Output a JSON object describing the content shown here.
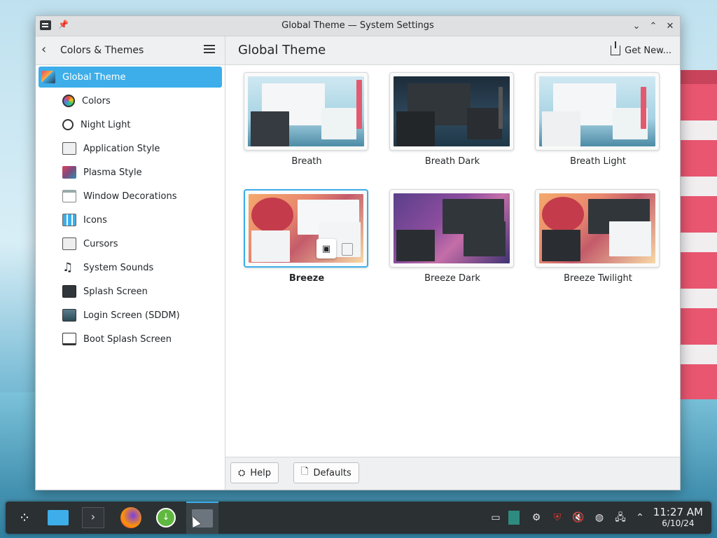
{
  "window": {
    "title": "Global Theme — System Settings"
  },
  "header": {
    "sidebar_title": "Colors & Themes",
    "page_title": "Global Theme",
    "get_new_label": "Get New..."
  },
  "sidebar": {
    "items": [
      {
        "label": "Global Theme",
        "icon": "global-theme-icon",
        "active": true
      },
      {
        "label": "Colors",
        "icon": "colors-icon"
      },
      {
        "label": "Night Light",
        "icon": "night-light-icon"
      },
      {
        "label": "Application Style",
        "icon": "application-style-icon"
      },
      {
        "label": "Plasma Style",
        "icon": "plasma-style-icon"
      },
      {
        "label": "Window Decorations",
        "icon": "window-decorations-icon"
      },
      {
        "label": "Icons",
        "icon": "icons-icon"
      },
      {
        "label": "Cursors",
        "icon": "cursors-icon"
      },
      {
        "label": "System Sounds",
        "icon": "music-note-icon"
      },
      {
        "label": "Splash Screen",
        "icon": "splash-screen-icon"
      },
      {
        "label": "Login Screen (SDDM)",
        "icon": "login-screen-icon"
      },
      {
        "label": "Boot Splash Screen",
        "icon": "boot-splash-icon"
      }
    ]
  },
  "themes": [
    {
      "label": "Breath",
      "style": "light-blue"
    },
    {
      "label": "Breath Dark",
      "style": "dark-blue"
    },
    {
      "label": "Breath Light",
      "style": "light-blue"
    },
    {
      "label": "Breeze",
      "style": "light-warm",
      "selected": true
    },
    {
      "label": "Breeze Dark",
      "style": "dark-warm"
    },
    {
      "label": "Breeze Twilight",
      "style": "twilight-warm"
    }
  ],
  "footer": {
    "help_label": "Help",
    "defaults_label": "Defaults"
  },
  "taskbar": {
    "time": "11:27 AM",
    "date": "6/10/24"
  },
  "colors": {
    "accent": "#3daee9",
    "taskbar": "#2b3033"
  }
}
